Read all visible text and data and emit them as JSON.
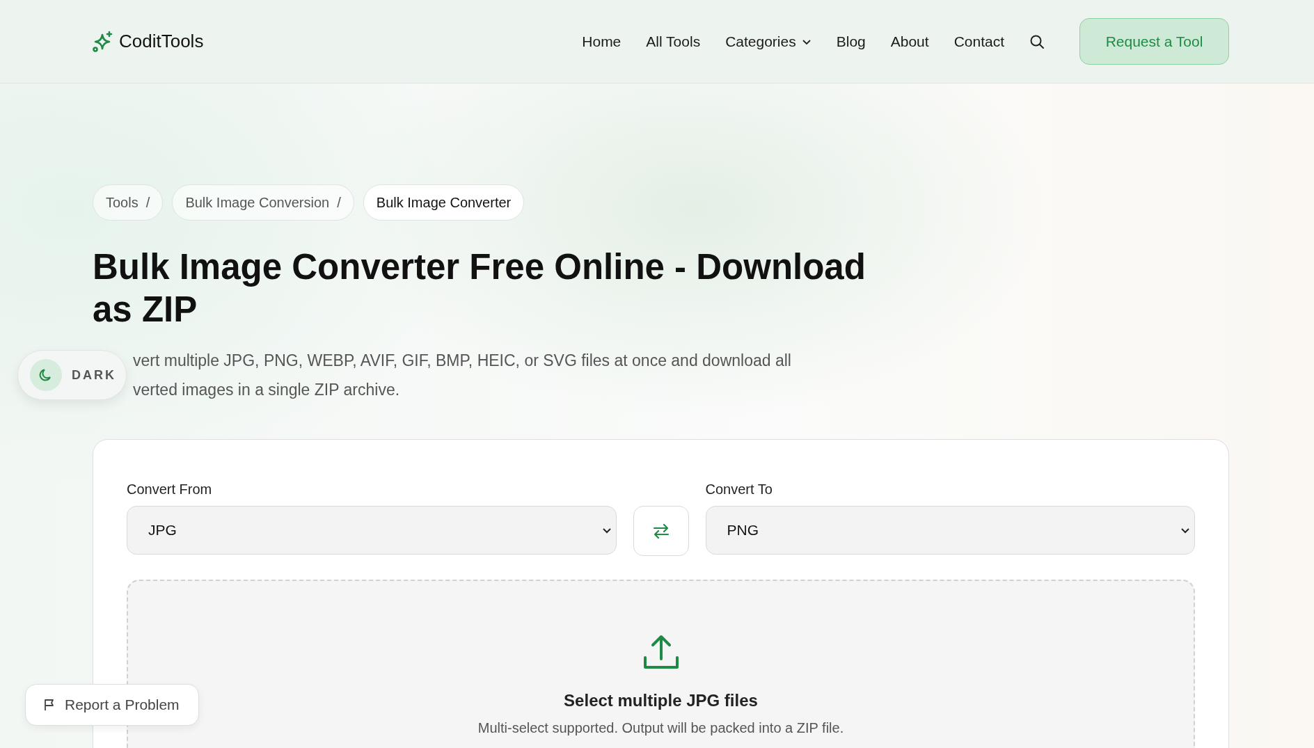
{
  "header": {
    "logo": "CoditTools",
    "nav": [
      {
        "label": "Home",
        "kind": "link"
      },
      {
        "label": "All Tools",
        "kind": "link"
      },
      {
        "label": "Categories",
        "kind": "dropdown"
      },
      {
        "label": "Blog",
        "kind": "link"
      },
      {
        "label": "About",
        "kind": "link"
      },
      {
        "label": "Contact",
        "kind": "link"
      }
    ],
    "cta": "Request a Tool"
  },
  "breadcrumbs": [
    {
      "label": "Tools",
      "separator": "/"
    },
    {
      "label": "Bulk Image Conversion",
      "separator": "/"
    },
    {
      "label": "Bulk Image Converter"
    }
  ],
  "title": "Bulk Image Converter Free Online - Download as ZIP",
  "description_lines": [
    "vert multiple JPG, PNG, WEBP, AVIF, GIF, BMP, HEIC, or SVG files at once and download all",
    "verted images in a single ZIP archive."
  ],
  "theme_toggle": {
    "label": "DARK"
  },
  "converter": {
    "from": {
      "label": "Convert From",
      "value": "JPG"
    },
    "to": {
      "label": "Convert To",
      "value": "PNG"
    },
    "dropzone": {
      "title": "Select multiple JPG files",
      "hint": "Multi-select supported. Output will be packed into a ZIP file."
    }
  },
  "report_button": "Report a Problem"
}
